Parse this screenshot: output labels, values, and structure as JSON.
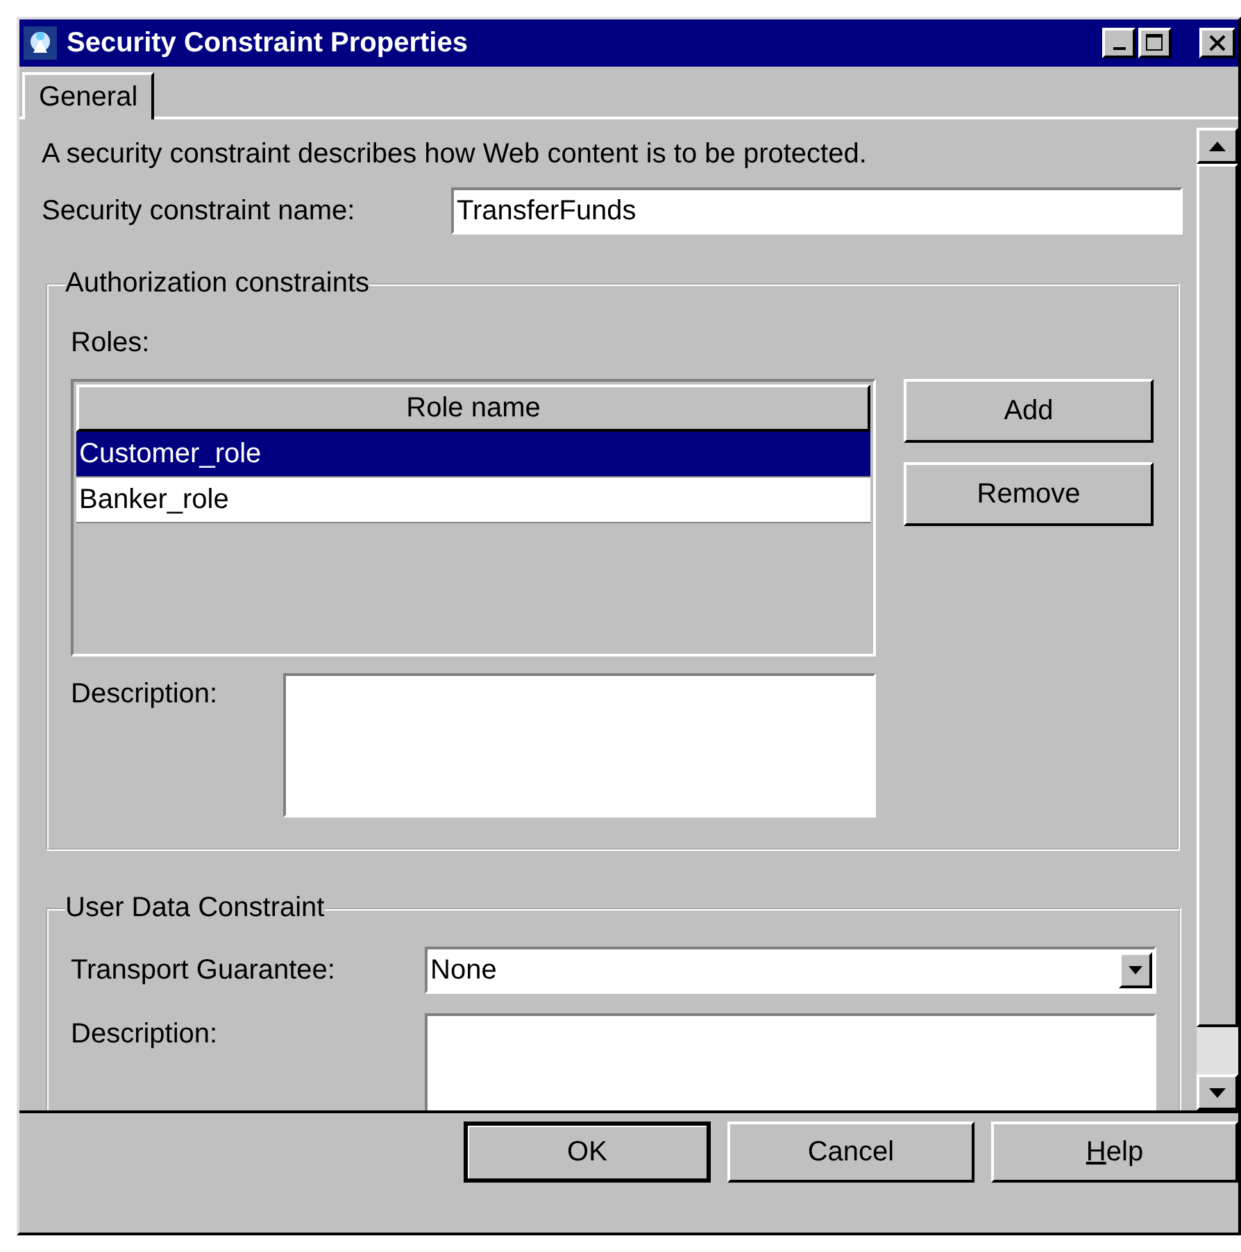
{
  "window": {
    "title": "Security Constraint Properties"
  },
  "tabs": [
    {
      "label": "General",
      "selected": true
    }
  ],
  "intro": "A security constraint describes how Web content is to be protected.",
  "name_field": {
    "label": "Security constraint name:",
    "value": "TransferFunds"
  },
  "authorization": {
    "title": "Authorization constraints",
    "roles_label": "Roles:",
    "table": {
      "columns": [
        "Role name"
      ],
      "rows": [
        {
          "cells": [
            "Customer_role"
          ],
          "selected": true
        },
        {
          "cells": [
            "Banker_role"
          ],
          "selected": false
        }
      ]
    },
    "buttons": [
      "Add",
      "Remove"
    ],
    "description": {
      "label": "Description:"
    }
  },
  "user_data": {
    "title": "User Data Constraint",
    "transport": {
      "label": "Transport Guarantee:",
      "value": "None"
    },
    "description": {
      "label": "Description:"
    }
  },
  "buttons": [
    {
      "label": "OK",
      "default": true
    },
    {
      "label": "Cancel",
      "default": false
    },
    {
      "label_parts": [
        {
          "text": "H",
          "underline": true
        },
        {
          "text": "elp",
          "underline": false
        }
      ],
      "default": false
    }
  ]
}
